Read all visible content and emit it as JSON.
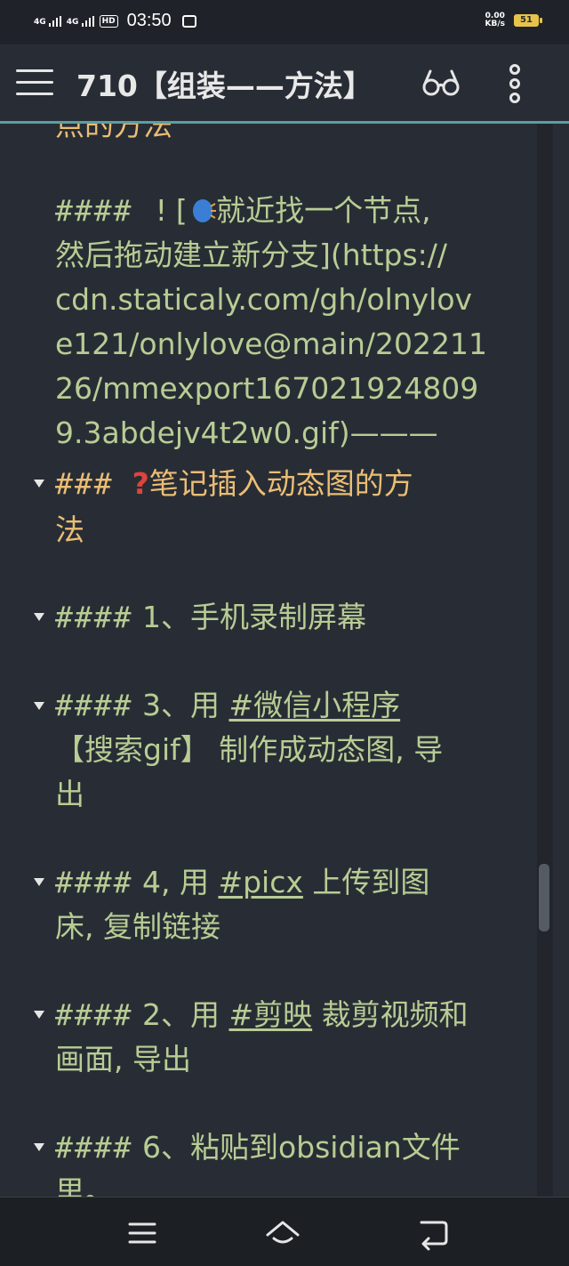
{
  "status_bar": {
    "signal1": "4G",
    "signal2": "4G",
    "hd": "HD",
    "time": "03:50",
    "net_speed_value": "0.00",
    "net_speed_unit": "KB/s",
    "battery": "51"
  },
  "header": {
    "title": "710【组装——方法】"
  },
  "content": {
    "top_cut_text": "点的方法",
    "h4_link_prefix": "#### ![",
    "h4_link_text1": "就近找一个节点,",
    "h4_link_text2": "然后拖动建立新分支](https://",
    "h4_link_text3": "cdn.staticaly.com/gh/olnylov",
    "h4_link_text4": "e121/onlylove@main/202211",
    "h4_link_text5": "26/mmexport167021924809",
    "h4_link_text6": "9.3abdejv4t2w0.gif)———",
    "h3_prefix": "###",
    "h3_title_line1": "笔记插入动态图的方",
    "h3_title_line2": "法",
    "items": [
      {
        "prefix": "####",
        "text": " 1、手机录制屏幕"
      },
      {
        "prefix": "####",
        "text_before": " 3、用 ",
        "tag": "#微信小程序",
        "line2": "【搜索gif】 制作成动态图, 导",
        "line3": "出"
      },
      {
        "prefix": "####",
        "text_before": " 4, 用 ",
        "tag": "#picx",
        "text_after": " 上传到图",
        "line2": "床, 复制链接"
      },
      {
        "prefix": "####",
        "text_before": " 2、用 ",
        "tag": "#剪映",
        "text_after": " 裁剪视频和",
        "line2": "画面, 导出"
      },
      {
        "prefix": "####",
        "text": " 6、粘贴到obsidian文件",
        "line2": "里。"
      }
    ]
  },
  "colors": {
    "background": "#282d35",
    "text_green": "#b9cc94",
    "heading_orange": "#ebbd74",
    "accent_teal": "#5c9ea0"
  },
  "icons": {
    "menu": "hamburger-icon",
    "reading_mode": "glasses-icon",
    "more": "more-vertical-icon",
    "speaker": "speaking-head-emoji",
    "question": "red-question-mark-emoji"
  }
}
